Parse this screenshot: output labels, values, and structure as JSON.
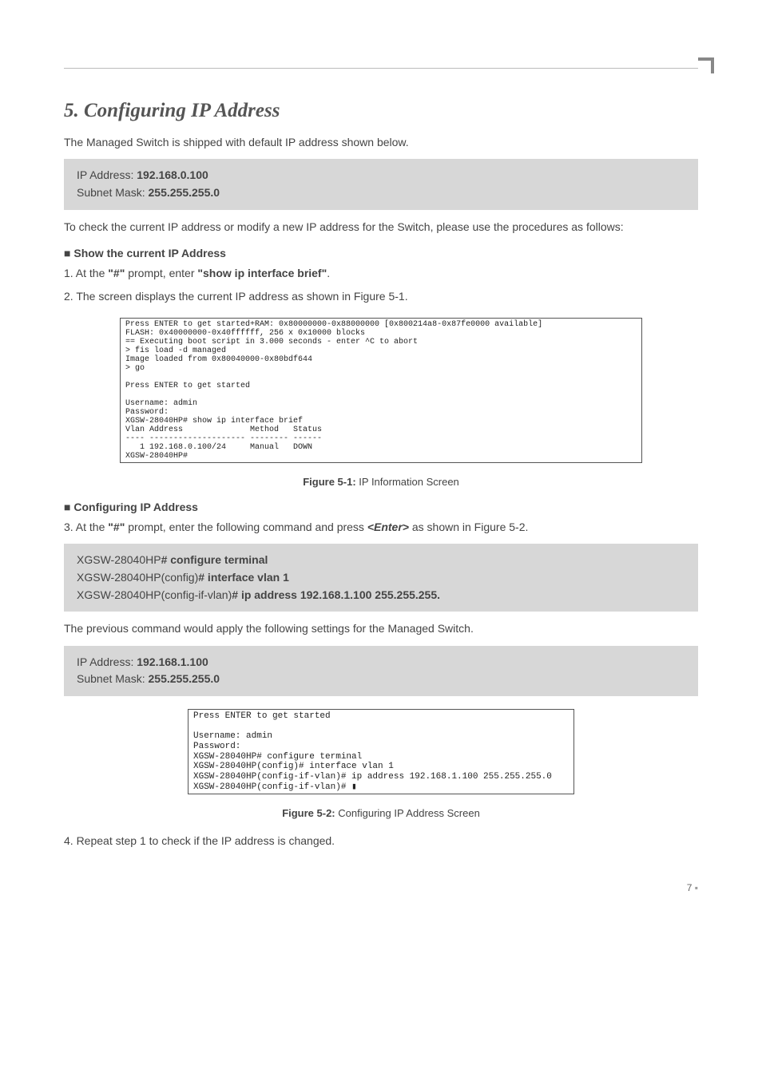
{
  "title": "5. Configuring IP Address",
  "intro": "The Managed Switch is shipped with default IP address shown below.",
  "defaults": {
    "ip_label": "IP Address: ",
    "ip": "192.168.0.100",
    "mask_label": "Subnet Mask: ",
    "mask": "255.255.255.0"
  },
  "check_text": "To check the current IP address or modify a new IP address for the Switch, please use the procedures as follows:",
  "sub1": "Show the current IP Address",
  "step1_pre": "1. At the ",
  "step1_prompt": "\"#\"",
  "step1_mid": " prompt, enter ",
  "step1_cmd": "\"show ip interface brief\"",
  "step1_post": ".",
  "step2": "2. The screen displays the current IP address as shown in Figure 5-1.",
  "terminal1": "Press ENTER to get started+RAM: 0x80000000-0x88000000 [0x800214a8-0x87fe0000 available]\nFLASH: 0x40000000-0x40ffffff, 256 x 0x10000 blocks\n== Executing boot script in 3.000 seconds - enter ^C to abort\n> fis load -d managed\nImage loaded from 0x80040000-0x80bdf644\n> go\n\nPress ENTER to get started\n\nUsername: admin\nPassword:\nXGSW-28040HP# show ip interface brief\nVlan Address              Method   Status\n---- -------------------- -------- ------\n   1 192.168.0.100/24     Manual   DOWN\nXGSW-28040HP#",
  "fig1_label": "Figure 5-1:",
  "fig1_text": "  IP Information Screen",
  "sub2": "Configuring IP Address",
  "step3_pre": "3. At the ",
  "step3_prompt": "\"#\"",
  "step3_mid": " prompt, enter the following command and press ",
  "step3_enter": "<Enter>",
  "step3_post": " as shown in Figure 5-2.",
  "cmdbox": {
    "l1a": "XGSW-28040HP",
    "l1b": "# configure terminal",
    "l2a": "XGSW-28040HP(config)",
    "l2b": "# interface vlan 1",
    "l3a": "XGSW-28040HP(config-if-vlan)",
    "l3b": "# ip address 192.168.1.100 255.255.255."
  },
  "applied_text": "The previous command would apply the following settings for the Managed Switch.",
  "newip": {
    "ip_label": "IP Address: ",
    "ip": "192.168.1.100",
    "mask_label": "Subnet Mask: ",
    "mask": "255.255.255.0"
  },
  "terminal2": "Press ENTER to get started\n\nUsername: admin\nPassword:\nXGSW-28040HP# configure terminal\nXGSW-28040HP(config)# interface vlan 1\nXGSW-28040HP(config-if-vlan)# ip address 192.168.1.100 255.255.255.0\nXGSW-28040HP(config-if-vlan)# ▮",
  "fig2_label": "Figure 5-2:",
  "fig2_text": "  Configuring IP Address Screen",
  "step4": "4. Repeat step 1 to check if the IP address is changed.",
  "page_number": "7"
}
